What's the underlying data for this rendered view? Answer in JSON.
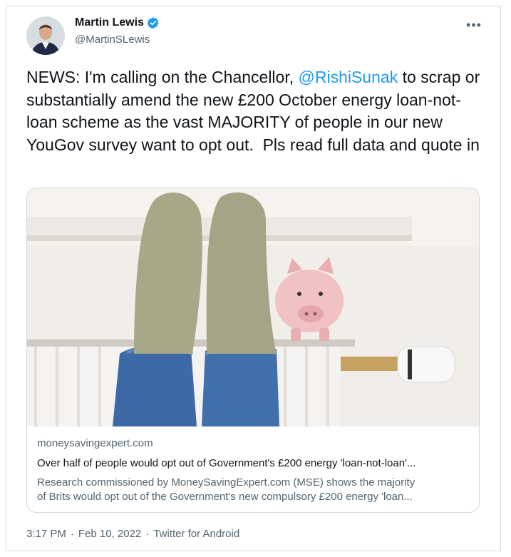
{
  "author": {
    "display_name": "Martin Lewis",
    "handle": "@MartinSLewis",
    "verified_icon": "verified-badge-icon",
    "more_icon": "more-options-icon"
  },
  "tweet": {
    "text_before": "NEWS: I'm calling on the Chancellor, ",
    "mention": "@RishiSunak",
    "text_after": " to scrap or substantially amend the new £200 October energy loan-not-loan scheme as the vast MAJORITY of people in our new YouGov survey want to opt out.  Pls read full data and quote in"
  },
  "card": {
    "domain": "moneysavingexpert.com",
    "title": "Over half of people would opt out of Government's £200 energy 'loan-not-loan'...",
    "description_line1": "Research commissioned by MoneySavingExpert.com (MSE) shows the majority",
    "description_line2": "of Brits would opt out of the Government's new compulsory £200 energy 'loan..."
  },
  "footer": {
    "time": "3:17 PM",
    "date": "Feb 10, 2022",
    "source": "Twitter for Android",
    "separator": "·"
  },
  "colors": {
    "accent": "#1d9bf0",
    "text": "#0f1419",
    "secondary": "#536471",
    "border": "#cfd9de"
  }
}
